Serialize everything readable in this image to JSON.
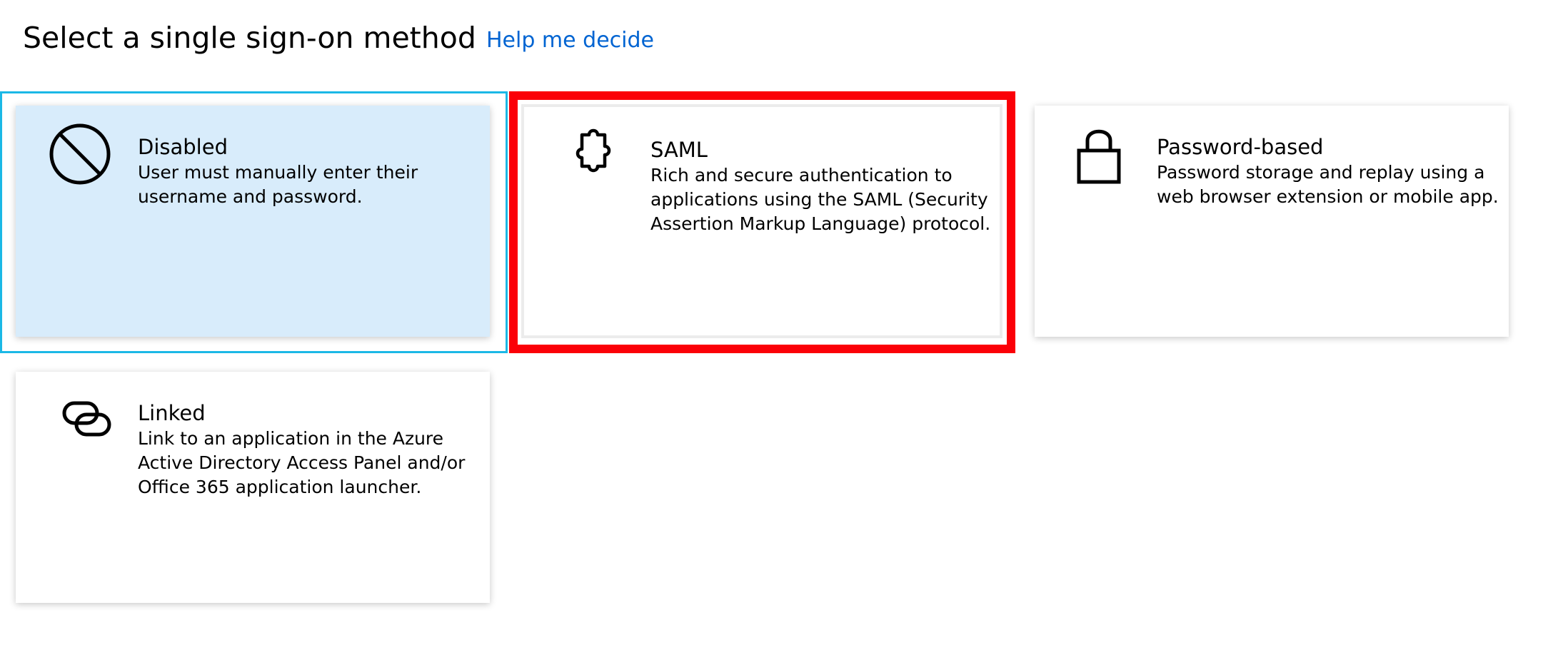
{
  "header": {
    "title": "Select a single sign-on method",
    "help_link": "Help me decide"
  },
  "cards": [
    {
      "id": "disabled",
      "title": "Disabled",
      "description": "User must manually enter their username and password.",
      "icon": "no-entry-icon",
      "selected": true
    },
    {
      "id": "saml",
      "title": "SAML",
      "description": "Rich and secure authentication to applications using the SAML (Security Assertion Markup Language) protocol.",
      "icon": "puzzle-piece-icon",
      "highlighted": true
    },
    {
      "id": "password",
      "title": "Password-based",
      "description": "Password storage and replay using a web browser extension or mobile app.",
      "icon": "lock-icon"
    },
    {
      "id": "linked",
      "title": "Linked",
      "description": "Link to an application in the Azure Active Directory Access Panel and/or Office 365 application launcher.",
      "icon": "link-icon"
    }
  ],
  "colors": {
    "link": "#0064d2",
    "selected_card_bg": "#d8ecfb",
    "selected_outline": "#1bb8e6",
    "highlight_box": "#fb0008"
  }
}
